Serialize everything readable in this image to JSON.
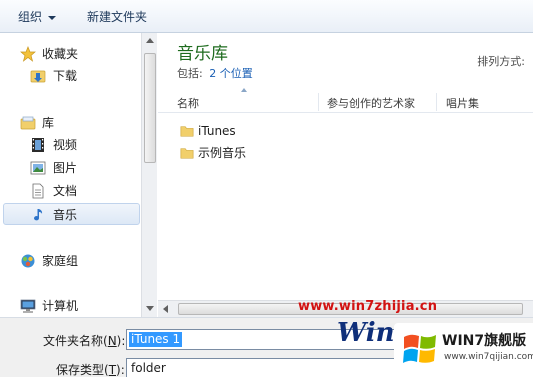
{
  "toolbar": {
    "organize_label": "组织",
    "new_folder_label": "新建文件夹"
  },
  "nav": {
    "favorites": "收藏夹",
    "downloads": "下载",
    "libraries": "库",
    "videos": "视频",
    "pictures": "图片",
    "documents": "文档",
    "music": "音乐",
    "homegroup": "家庭组",
    "computer": "计算机"
  },
  "content": {
    "title": "音乐库",
    "includes_label": "包括:",
    "includes_link": "2 个位置",
    "sort_label": "排列方式:",
    "columns": [
      "名称",
      "参与创作的艺术家",
      "唱片集"
    ],
    "items": [
      "iTunes",
      "示例音乐"
    ]
  },
  "form": {
    "filename_label": "文件夹名称(N):",
    "filename_label_pre": "文件夹名称(",
    "filename_key": "N",
    "filename_label_post": "):",
    "filename_value": "iTunes 1",
    "type_label_pre": "保存类型(",
    "type_key": "T",
    "type_label_post": "):",
    "type_value": "folder"
  },
  "watermark": {
    "url": "www.win7zhijia.cn",
    "logo": "Win",
    "badge_text": "WIN7旗舰版",
    "badge_url": "www.win7qijian.com"
  },
  "colors": {
    "library_title": "#1e6b1e",
    "link": "#1a5fb4",
    "selection": "#3399ff",
    "watermark_red": "#d21212"
  },
  "icons": {
    "favorites": "star-icon",
    "downloads": "download-folder-icon",
    "libraries": "library-icon",
    "videos": "film-icon",
    "pictures": "picture-icon",
    "documents": "document-icon",
    "music": "music-note-icon",
    "homegroup": "homegroup-icon",
    "computer": "computer-icon",
    "folder": "folder-icon"
  }
}
